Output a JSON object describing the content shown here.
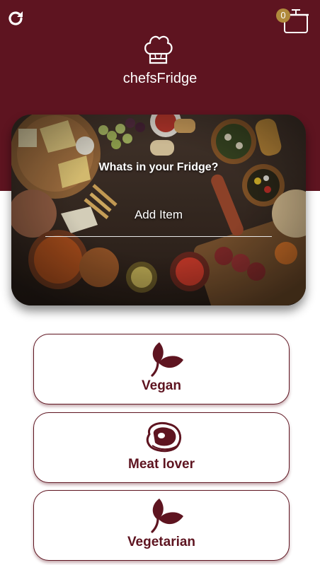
{
  "header": {
    "title": "chefsFridge",
    "cart_count": "0",
    "refresh_icon": "refresh-icon",
    "cart_icon": "pot-icon",
    "logo_icon": "chef-hat-icon",
    "background_color": "#5e1420"
  },
  "search_card": {
    "heading": "Whats in your Fridge?",
    "input_placeholder": "Add Item"
  },
  "categories": [
    {
      "label": "Vegan",
      "icon": "leaf-icon"
    },
    {
      "label": "Meat lover",
      "icon": "steak-icon"
    },
    {
      "label": "Vegetarian",
      "icon": "leaf-icon"
    }
  ],
  "colors": {
    "accent": "#5e1420",
    "badge": "#b08a3c"
  }
}
